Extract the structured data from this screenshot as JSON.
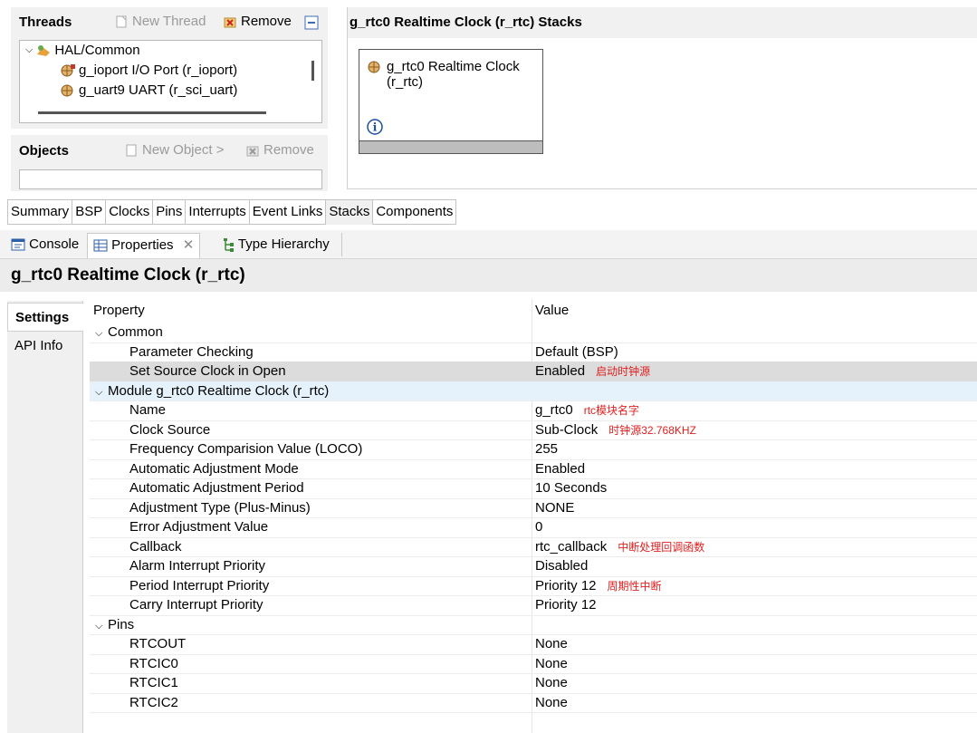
{
  "threads": {
    "title": "Threads",
    "new_thread": "New Thread",
    "remove": "Remove",
    "tree": [
      {
        "label": "HAL/Common",
        "level": 0
      },
      {
        "label": "g_ioport I/O Port (r_ioport)",
        "level": 1
      },
      {
        "label": "g_uart9 UART (r_sci_uart)",
        "level": 1
      }
    ]
  },
  "objects": {
    "title": "Objects",
    "new_object": "New Object >",
    "remove": "Remove"
  },
  "stacks": {
    "title": "g_rtc0 Realtime Clock (r_rtc) Stacks",
    "box_line1": "g_rtc0 Realtime Clock",
    "box_line2": "(r_rtc)"
  },
  "config_tabs": [
    "Summary",
    "BSP",
    "Clocks",
    "Pins",
    "Interrupts",
    "Event Links",
    "Stacks",
    "Components"
  ],
  "config_tab_active": "Stacks",
  "view_tabs": {
    "console": "Console",
    "properties": "Properties",
    "type_hierarchy": "Type Hierarchy"
  },
  "properties_title": "g_rtc0 Realtime Clock (r_rtc)",
  "side_tabs": {
    "settings": "Settings",
    "api_info": "API Info"
  },
  "table": {
    "col_property": "Property",
    "col_value": "Value",
    "rows": [
      {
        "key": "Common",
        "value": "",
        "indent": 0,
        "group": true
      },
      {
        "key": "Parameter Checking",
        "value": "Default (BSP)",
        "indent": 1
      },
      {
        "key": "Set Source Clock in Open",
        "value": "Enabled",
        "indent": 1,
        "note": "启动时钟源"
      },
      {
        "key": "Module g_rtc0 Realtime Clock (r_rtc)",
        "value": "",
        "indent": 0,
        "group": true
      },
      {
        "key": "Name",
        "value": "g_rtc0",
        "indent": 1,
        "note": "rtc模块名字"
      },
      {
        "key": "Clock Source",
        "value": "Sub-Clock",
        "indent": 1,
        "note": "时钟源32.768KHZ"
      },
      {
        "key": "Frequency Comparision Value (LOCO)",
        "value": "255",
        "indent": 1
      },
      {
        "key": "Automatic Adjustment Mode",
        "value": "Enabled",
        "indent": 1
      },
      {
        "key": "Automatic Adjustment Period",
        "value": "10 Seconds",
        "indent": 1
      },
      {
        "key": "Adjustment Type (Plus-Minus)",
        "value": "NONE",
        "indent": 1
      },
      {
        "key": "Error Adjustment Value",
        "value": "0",
        "indent": 1
      },
      {
        "key": "Callback",
        "value": "rtc_callback",
        "indent": 1,
        "note": "中断处理回调函数"
      },
      {
        "key": "Alarm Interrupt Priority",
        "value": "Disabled",
        "indent": 1
      },
      {
        "key": "Period Interrupt Priority",
        "value": "Priority 12",
        "indent": 1,
        "note": "周期性中断"
      },
      {
        "key": "Carry Interrupt Priority",
        "value": "Priority 12",
        "indent": 1
      },
      {
        "key": "Pins",
        "value": "",
        "indent": 0,
        "group": true
      },
      {
        "key": "RTCOUT",
        "value": "None",
        "indent": 1
      },
      {
        "key": "RTCIC0",
        "value": "None",
        "indent": 1
      },
      {
        "key": "RTCIC1",
        "value": "None",
        "indent": 1
      },
      {
        "key": "RTCIC2",
        "value": "None",
        "indent": 1
      }
    ]
  },
  "colors": {
    "note": "#e02020",
    "selected_row": "#dcdcdc",
    "selected_group": "#e6f2fb"
  }
}
